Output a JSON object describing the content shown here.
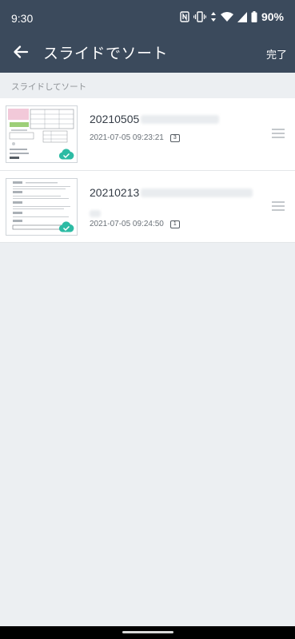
{
  "status_bar": {
    "time": "9:30",
    "battery": "90%"
  },
  "app_bar": {
    "title": "スライドでソート",
    "done_label": "完了"
  },
  "section": {
    "header": "スライドしてソート"
  },
  "documents": [
    {
      "name": "20210505",
      "datetime": "2021-07-05 09:23:21",
      "page_count": "3",
      "synced": true
    },
    {
      "name": "20210213",
      "datetime": "2021-07-05 09:24:50",
      "page_count": "1",
      "synced": true
    }
  ],
  "colors": {
    "app_bar": "#3b4a5c",
    "sync_badge": "#2dbba4",
    "background": "#eceff2"
  }
}
